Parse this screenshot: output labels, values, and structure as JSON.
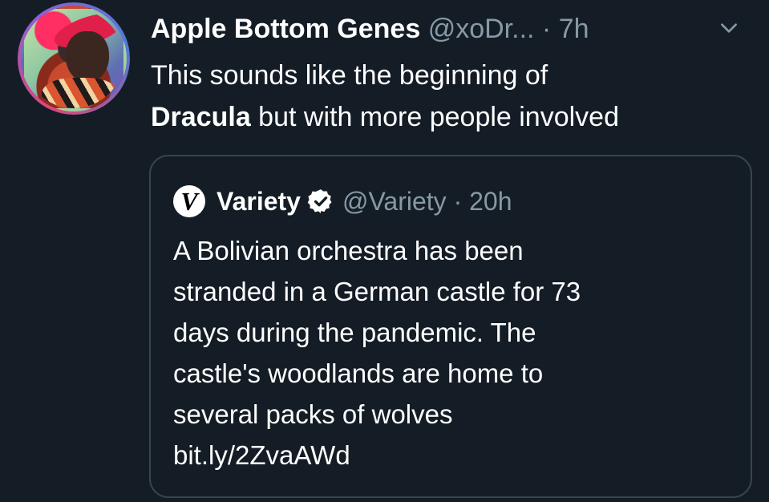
{
  "tweet": {
    "author_name": "Apple Bottom Genes",
    "author_handle": "@xoDr...",
    "separator": "·",
    "time": "7h",
    "text_part1": "This sounds like the beginning of",
    "text_bold": "Dracula",
    "text_part2": " but with more people involved",
    "menu_icon": "chevron-down-icon"
  },
  "quoted_tweet": {
    "logo_letter": "V",
    "author_name": "Variety",
    "verified_icon": "verified-badge-icon",
    "author_handle": "@Variety",
    "separator": "·",
    "time": "20h",
    "lines": [
      "A Bolivian orchestra has been",
      "stranded in a German castle for 73",
      "days during the pandemic. The",
      "castle's woodlands are home to",
      "several packs of wolves",
      "bit.ly/2ZvaAWd"
    ]
  },
  "colors": {
    "background": "#141d26",
    "text": "#ffffff",
    "secondary_text": "#8899a6",
    "border": "#38444d"
  }
}
